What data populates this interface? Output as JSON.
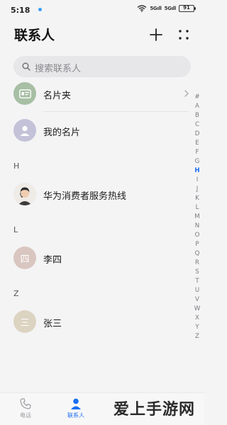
{
  "status_bar": {
    "time": "5:18",
    "signal_1": "ὧull",
    "signal_label_1": "5Gıll",
    "signal_label_2": "5Gıll",
    "battery": "91"
  },
  "header": {
    "title": "联系人"
  },
  "search": {
    "placeholder": "搜索联系人"
  },
  "contacts": [
    {
      "name": "名片夹",
      "icon": "business-card-icon",
      "color": "#a7bfa4"
    },
    {
      "name": "我的名片",
      "icon": "person-icon",
      "color": "#c3c2d8"
    }
  ],
  "sections": [
    {
      "letter": "H",
      "items": [
        {
          "name": "华为消费者服务热线",
          "icon": "service-agent-icon"
        }
      ]
    },
    {
      "letter": "L",
      "items": [
        {
          "name": "李四",
          "initial": "四",
          "color": "#d9c6c0"
        }
      ]
    },
    {
      "letter": "Z",
      "items": [
        {
          "name": "张三",
          "initial": "三",
          "color": "#dcd3c1"
        }
      ]
    }
  ],
  "index_bar": [
    "#",
    "A",
    "B",
    "C",
    "D",
    "E",
    "F",
    "G",
    "H",
    "I",
    "J",
    "K",
    "L",
    "M",
    "N",
    "O",
    "P",
    "Q",
    "R",
    "S",
    "T",
    "U",
    "V",
    "W",
    "X",
    "Y",
    "Z"
  ],
  "index_active": "H",
  "bottom_nav": [
    {
      "label": "电话",
      "icon": "phone-icon",
      "active": false
    },
    {
      "label": "联系人",
      "icon": "contacts-icon",
      "active": true
    }
  ],
  "watermark": "爱上手游网",
  "colors": {
    "accent": "#1a6df0",
    "background": "#f4f4f5"
  }
}
